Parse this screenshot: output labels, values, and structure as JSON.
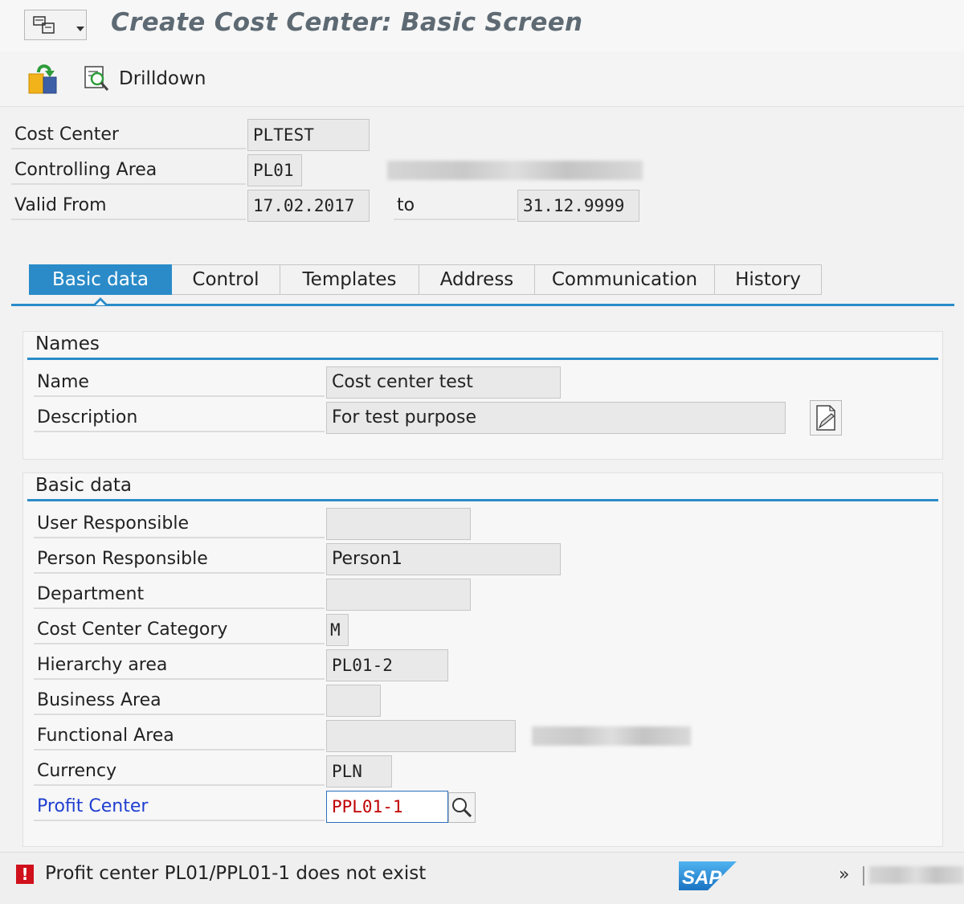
{
  "title": "Create Cost Center: Basic Screen",
  "toolbar": {
    "drilldown_label": "Drilldown"
  },
  "header": {
    "cost_center_label": "Cost Center",
    "cost_center_value": "PLTEST",
    "controlling_area_label": "Controlling Area",
    "controlling_area_value": "PL01",
    "valid_from_label": "Valid From",
    "valid_from_value": "17.02.2017",
    "to_label": "to",
    "valid_to_value": "31.12.9999"
  },
  "tabs": [
    {
      "label": "Basic data",
      "active": true
    },
    {
      "label": "Control",
      "active": false
    },
    {
      "label": "Templates",
      "active": false
    },
    {
      "label": "Address",
      "active": false
    },
    {
      "label": "Communication",
      "active": false
    },
    {
      "label": "History",
      "active": false
    }
  ],
  "names_group": {
    "title": "Names",
    "name_label": "Name",
    "name_value": "Cost center test",
    "description_label": "Description",
    "description_value": "For test purpose"
  },
  "basic_group": {
    "title": "Basic data",
    "user_responsible_label": "User Responsible",
    "user_responsible_value": "",
    "person_responsible_label": "Person Responsible",
    "person_responsible_value": "Person1",
    "department_label": "Department",
    "department_value": "",
    "category_label": "Cost Center Category",
    "category_value": "M",
    "hierarchy_label": "Hierarchy area",
    "hierarchy_value": "PL01-2",
    "business_area_label": "Business Area",
    "business_area_value": "",
    "functional_area_label": "Functional Area",
    "functional_area_value": "",
    "currency_label": "Currency",
    "currency_value": "PLN",
    "profit_center_label": "Profit Center",
    "profit_center_value": "PPL01-1"
  },
  "status": {
    "message": "Profit center PL01/PPL01-1 does not exist",
    "logo_text": "SAP",
    "expand_glyph": "»"
  },
  "colors": {
    "accent": "#2a8bc8",
    "error": "#d0101b",
    "link_label": "#1f3fd0",
    "error_value": "#c00000"
  }
}
